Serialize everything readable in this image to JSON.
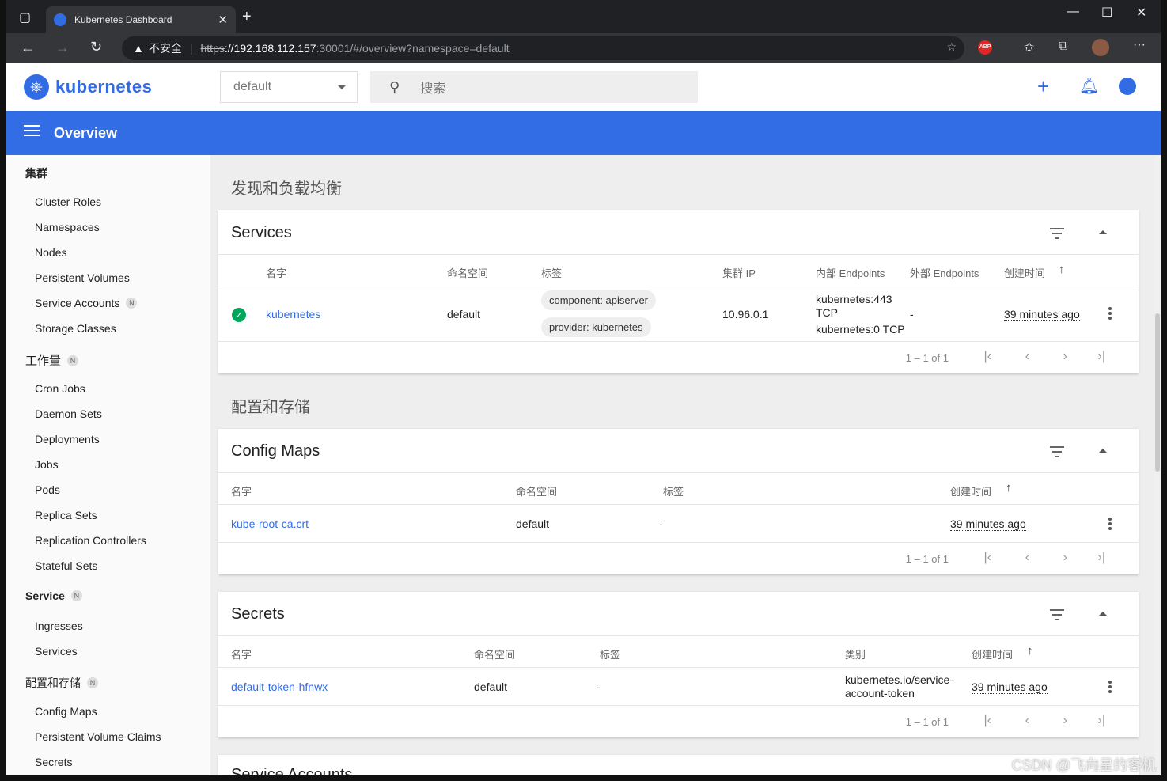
{
  "browser": {
    "tab_title": "Kubernetes Dashboard",
    "warning": "不安全",
    "url_scheme": "https",
    "url_host": "://192.168.112.157",
    "url_path": ":30001/#/overview?namespace=default"
  },
  "header": {
    "logo_text": "kubernetes",
    "namespace": "default",
    "search_placeholder": "搜索"
  },
  "toolbar": {
    "title": "Overview"
  },
  "sidebar": {
    "cluster_section": "集群",
    "cluster_items": [
      "Cluster Roles",
      "Namespaces",
      "Nodes",
      "Persistent Volumes",
      "Service Accounts",
      "Storage Classes"
    ],
    "workloads_section": "工作量",
    "workload_items": [
      "Cron Jobs",
      "Daemon Sets",
      "Deployments",
      "Jobs",
      "Pods",
      "Replica Sets",
      "Replication Controllers",
      "Stateful Sets"
    ],
    "service_section": "Service",
    "service_items": [
      "Ingresses",
      "Services"
    ],
    "config_section": "配置和存储",
    "config_items": [
      "Config Maps",
      "Persistent Volume Claims",
      "Secrets"
    ],
    "badge": "N"
  },
  "main": {
    "discovery_title": "发现和负载均衡",
    "config_title": "配置和存储",
    "services": {
      "title": "Services",
      "columns": [
        "名字",
        "命名空间",
        "标签",
        "集群 IP",
        "内部 Endpoints",
        "外部 Endpoints",
        "创建时间"
      ],
      "row": {
        "name": "kubernetes",
        "namespace": "default",
        "labels": [
          "component: apiserver",
          "provider: kubernetes"
        ],
        "cluster_ip": "10.96.0.1",
        "internal_ep_1": "kubernetes:443",
        "internal_ep_1b": "TCP",
        "internal_ep_2": "kubernetes:0 TCP",
        "external_ep": "-",
        "created": "39 minutes ago"
      },
      "range": "1 – 1 of 1"
    },
    "configmaps": {
      "title": "Config Maps",
      "columns": [
        "名字",
        "命名空间",
        "标签",
        "创建时间"
      ],
      "row": {
        "name": "kube-root-ca.crt",
        "namespace": "default",
        "labels": "-",
        "created": "39 minutes ago"
      },
      "range": "1 – 1 of 1"
    },
    "secrets": {
      "title": "Secrets",
      "columns": [
        "名字",
        "命名空间",
        "标签",
        "类别",
        "创建时间"
      ],
      "row": {
        "name": "default-token-hfnwx",
        "namespace": "default",
        "labels": "-",
        "type_1": "kubernetes.io/service-",
        "type_2": "account-token",
        "created": "39 minutes ago"
      },
      "range": "1 – 1 of 1"
    },
    "next_card_title": "Service Accounts"
  },
  "watermark": "CSDN @飞向星的客机"
}
